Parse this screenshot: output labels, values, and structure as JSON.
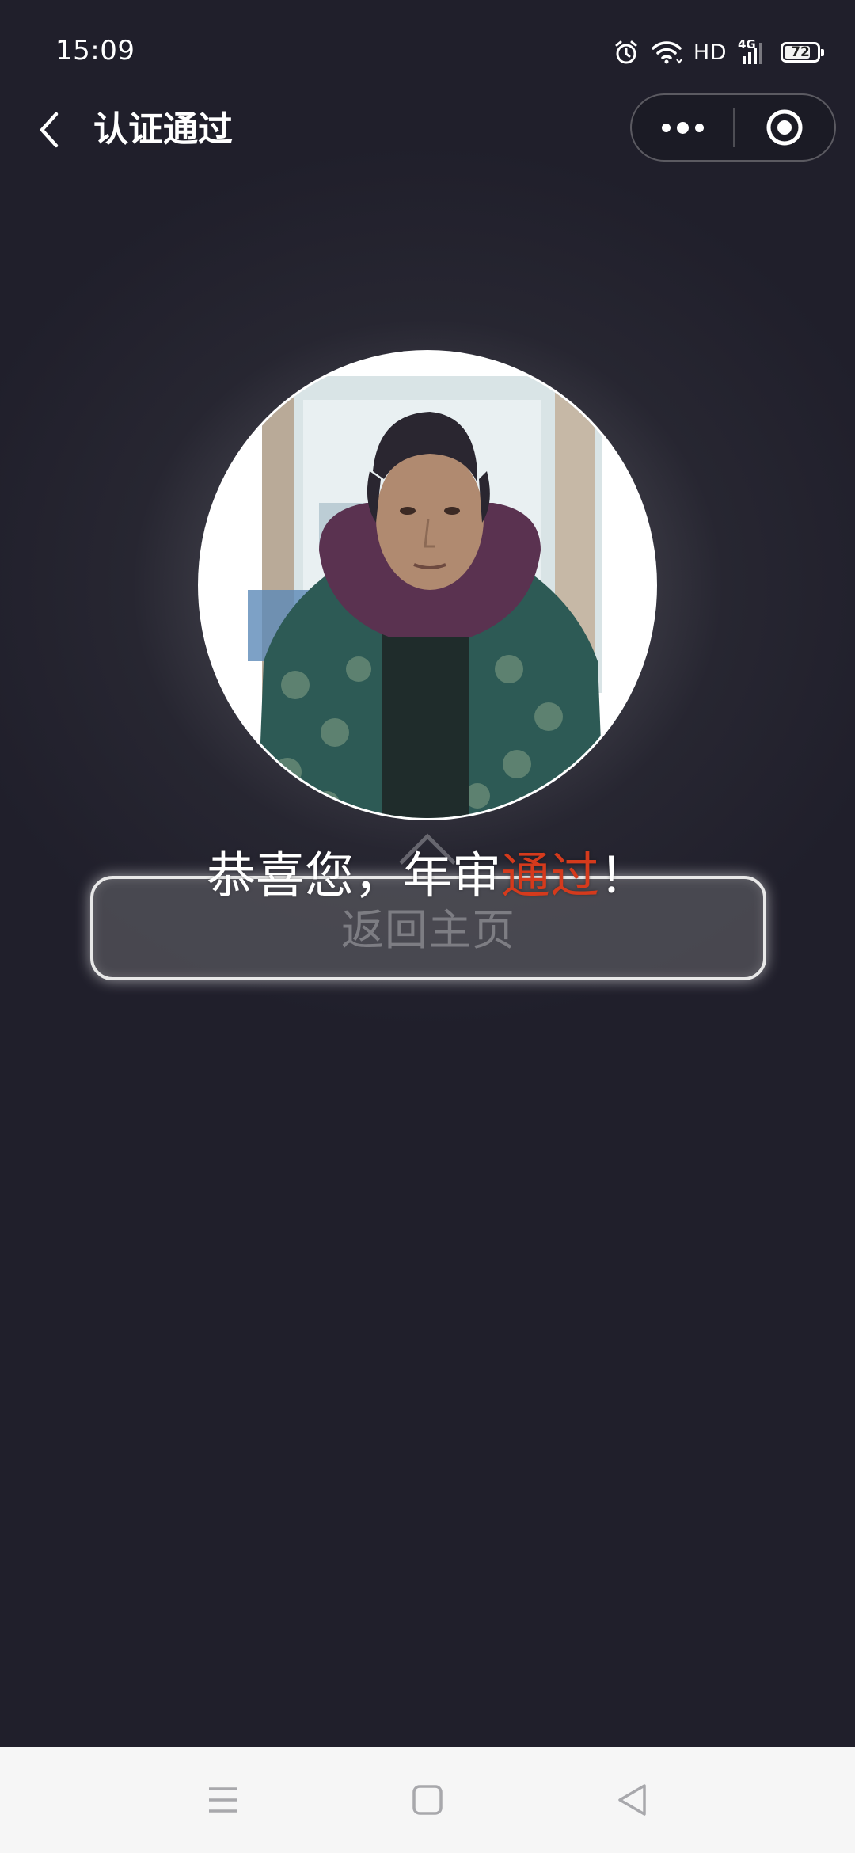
{
  "status_bar": {
    "time": "15:09",
    "network_label": "HD",
    "cellular_label": "4G",
    "battery_level": "72",
    "icons": [
      "alarm-icon",
      "wifi-icon",
      "cellular-signal-icon",
      "battery-icon"
    ]
  },
  "nav": {
    "title": "认证通过",
    "back_icon": "chevron-left-icon",
    "more_icon": "more-dots-icon",
    "close_icon": "target-close-icon"
  },
  "avatar": {
    "icon": "face-photo",
    "colors": {
      "coat": "#2d5a55",
      "scarf": "#5a3250",
      "hair": "#2a2630",
      "skin": "#b08a70"
    }
  },
  "result": {
    "prefix": "恭喜您，年审",
    "highlight": "通过",
    "suffix": "！",
    "highlight_color": "#d53a1c"
  },
  "home_button": {
    "label": "返回主页"
  },
  "system_nav": {
    "menu_icon": "menu-lines-icon",
    "home_icon": "square-home-icon",
    "back_icon": "triangle-back-icon"
  },
  "colors": {
    "background": "#201f2b",
    "bottom_bar": "#f6f6f6"
  }
}
